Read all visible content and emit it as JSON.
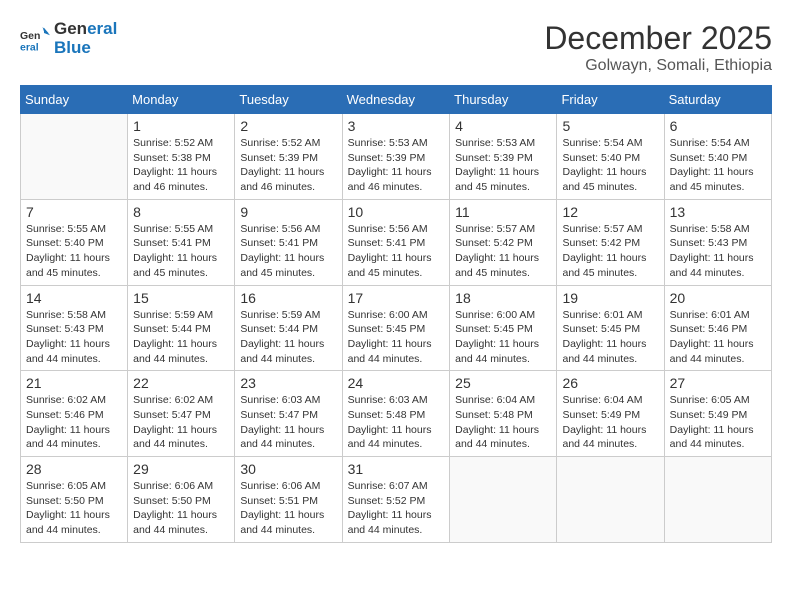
{
  "logo": {
    "line1": "General",
    "line2": "Blue"
  },
  "title": "December 2025",
  "subtitle": "Golwayn, Somali, Ethiopia",
  "weekdays": [
    "Sunday",
    "Monday",
    "Tuesday",
    "Wednesday",
    "Thursday",
    "Friday",
    "Saturday"
  ],
  "weeks": [
    [
      {
        "day": "",
        "info": ""
      },
      {
        "day": "1",
        "info": "Sunrise: 5:52 AM\nSunset: 5:38 PM\nDaylight: 11 hours\nand 46 minutes."
      },
      {
        "day": "2",
        "info": "Sunrise: 5:52 AM\nSunset: 5:39 PM\nDaylight: 11 hours\nand 46 minutes."
      },
      {
        "day": "3",
        "info": "Sunrise: 5:53 AM\nSunset: 5:39 PM\nDaylight: 11 hours\nand 46 minutes."
      },
      {
        "day": "4",
        "info": "Sunrise: 5:53 AM\nSunset: 5:39 PM\nDaylight: 11 hours\nand 45 minutes."
      },
      {
        "day": "5",
        "info": "Sunrise: 5:54 AM\nSunset: 5:40 PM\nDaylight: 11 hours\nand 45 minutes."
      },
      {
        "day": "6",
        "info": "Sunrise: 5:54 AM\nSunset: 5:40 PM\nDaylight: 11 hours\nand 45 minutes."
      }
    ],
    [
      {
        "day": "7",
        "info": "Sunrise: 5:55 AM\nSunset: 5:40 PM\nDaylight: 11 hours\nand 45 minutes."
      },
      {
        "day": "8",
        "info": "Sunrise: 5:55 AM\nSunset: 5:41 PM\nDaylight: 11 hours\nand 45 minutes."
      },
      {
        "day": "9",
        "info": "Sunrise: 5:56 AM\nSunset: 5:41 PM\nDaylight: 11 hours\nand 45 minutes."
      },
      {
        "day": "10",
        "info": "Sunrise: 5:56 AM\nSunset: 5:41 PM\nDaylight: 11 hours\nand 45 minutes."
      },
      {
        "day": "11",
        "info": "Sunrise: 5:57 AM\nSunset: 5:42 PM\nDaylight: 11 hours\nand 45 minutes."
      },
      {
        "day": "12",
        "info": "Sunrise: 5:57 AM\nSunset: 5:42 PM\nDaylight: 11 hours\nand 45 minutes."
      },
      {
        "day": "13",
        "info": "Sunrise: 5:58 AM\nSunset: 5:43 PM\nDaylight: 11 hours\nand 44 minutes."
      }
    ],
    [
      {
        "day": "14",
        "info": "Sunrise: 5:58 AM\nSunset: 5:43 PM\nDaylight: 11 hours\nand 44 minutes."
      },
      {
        "day": "15",
        "info": "Sunrise: 5:59 AM\nSunset: 5:44 PM\nDaylight: 11 hours\nand 44 minutes."
      },
      {
        "day": "16",
        "info": "Sunrise: 5:59 AM\nSunset: 5:44 PM\nDaylight: 11 hours\nand 44 minutes."
      },
      {
        "day": "17",
        "info": "Sunrise: 6:00 AM\nSunset: 5:45 PM\nDaylight: 11 hours\nand 44 minutes."
      },
      {
        "day": "18",
        "info": "Sunrise: 6:00 AM\nSunset: 5:45 PM\nDaylight: 11 hours\nand 44 minutes."
      },
      {
        "day": "19",
        "info": "Sunrise: 6:01 AM\nSunset: 5:45 PM\nDaylight: 11 hours\nand 44 minutes."
      },
      {
        "day": "20",
        "info": "Sunrise: 6:01 AM\nSunset: 5:46 PM\nDaylight: 11 hours\nand 44 minutes."
      }
    ],
    [
      {
        "day": "21",
        "info": "Sunrise: 6:02 AM\nSunset: 5:46 PM\nDaylight: 11 hours\nand 44 minutes."
      },
      {
        "day": "22",
        "info": "Sunrise: 6:02 AM\nSunset: 5:47 PM\nDaylight: 11 hours\nand 44 minutes."
      },
      {
        "day": "23",
        "info": "Sunrise: 6:03 AM\nSunset: 5:47 PM\nDaylight: 11 hours\nand 44 minutes."
      },
      {
        "day": "24",
        "info": "Sunrise: 6:03 AM\nSunset: 5:48 PM\nDaylight: 11 hours\nand 44 minutes."
      },
      {
        "day": "25",
        "info": "Sunrise: 6:04 AM\nSunset: 5:48 PM\nDaylight: 11 hours\nand 44 minutes."
      },
      {
        "day": "26",
        "info": "Sunrise: 6:04 AM\nSunset: 5:49 PM\nDaylight: 11 hours\nand 44 minutes."
      },
      {
        "day": "27",
        "info": "Sunrise: 6:05 AM\nSunset: 5:49 PM\nDaylight: 11 hours\nand 44 minutes."
      }
    ],
    [
      {
        "day": "28",
        "info": "Sunrise: 6:05 AM\nSunset: 5:50 PM\nDaylight: 11 hours\nand 44 minutes."
      },
      {
        "day": "29",
        "info": "Sunrise: 6:06 AM\nSunset: 5:50 PM\nDaylight: 11 hours\nand 44 minutes."
      },
      {
        "day": "30",
        "info": "Sunrise: 6:06 AM\nSunset: 5:51 PM\nDaylight: 11 hours\nand 44 minutes."
      },
      {
        "day": "31",
        "info": "Sunrise: 6:07 AM\nSunset: 5:52 PM\nDaylight: 11 hours\nand 44 minutes."
      },
      {
        "day": "",
        "info": ""
      },
      {
        "day": "",
        "info": ""
      },
      {
        "day": "",
        "info": ""
      }
    ]
  ]
}
